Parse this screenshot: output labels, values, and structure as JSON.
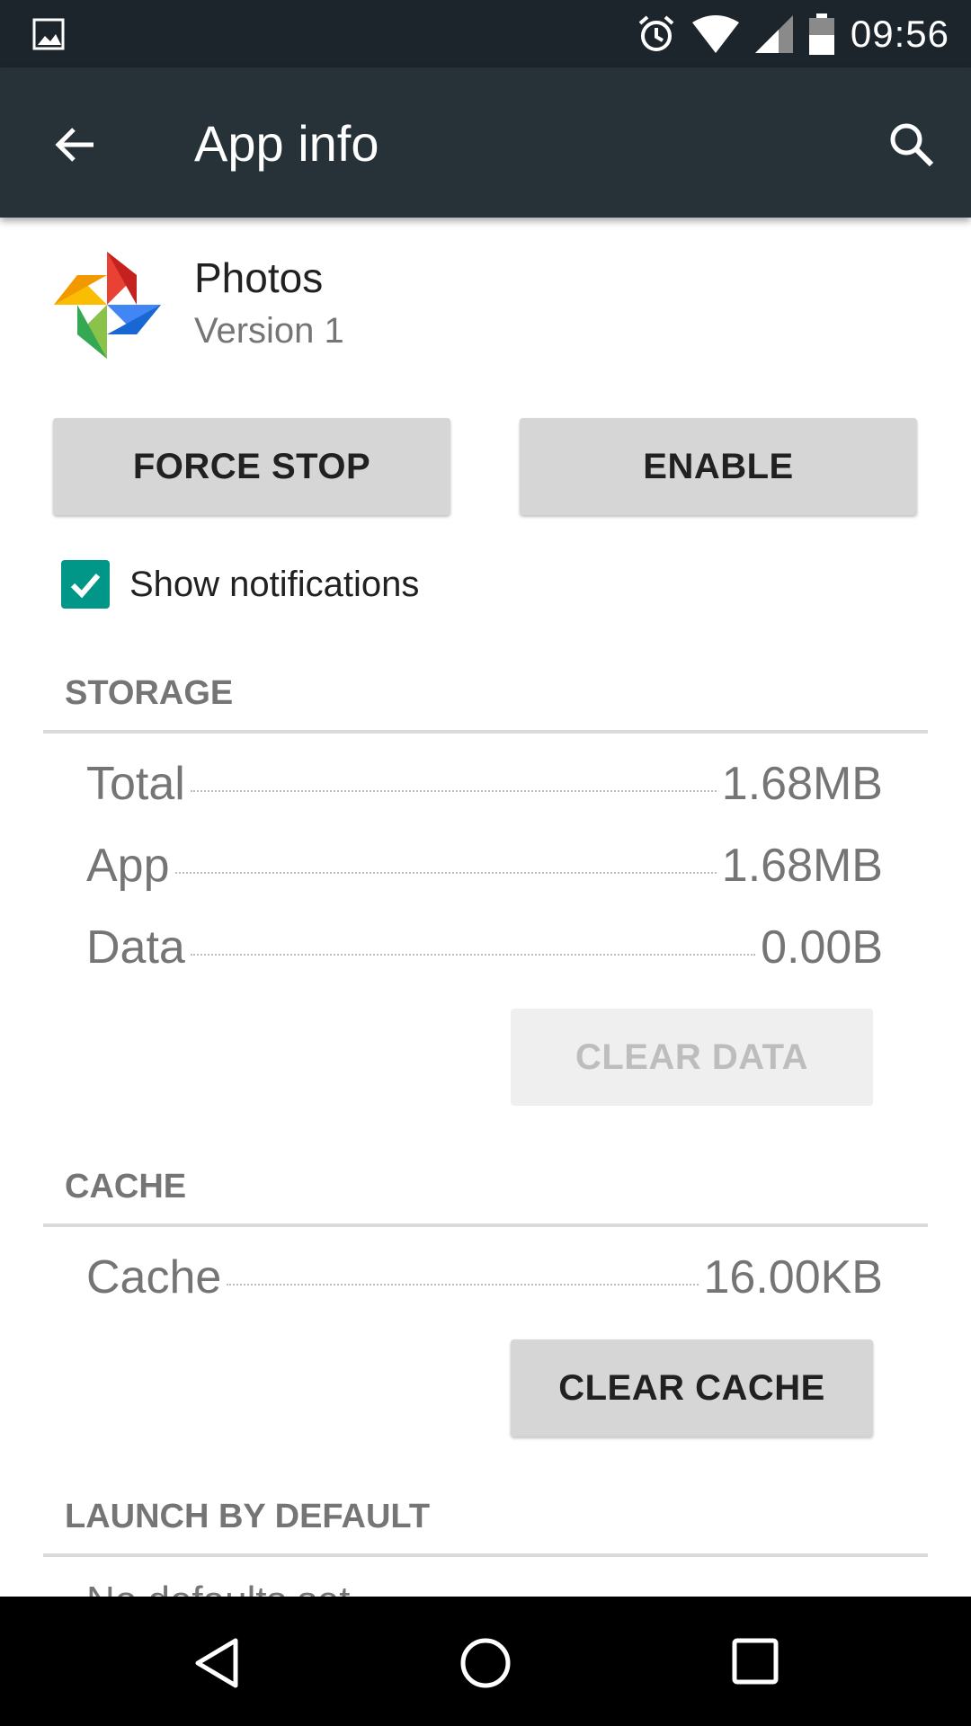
{
  "status_bar": {
    "time": "09:56",
    "icons": [
      "image-notification-icon",
      "alarm-icon",
      "wifi-icon",
      "signal-icon",
      "battery-icon"
    ]
  },
  "toolbar": {
    "title": "App info",
    "back_icon": "arrow-back-icon",
    "search_icon": "search-icon",
    "bg_color": "#263238"
  },
  "app": {
    "name": "Photos",
    "version": "Version 1",
    "icon": "google-photos-pinwheel-icon"
  },
  "actions": {
    "force_stop_label": "FORCE STOP",
    "enable_label": "ENABLE"
  },
  "notifications": {
    "label": "Show notifications",
    "checked": true,
    "accent_color": "#009688"
  },
  "storage": {
    "header": "STORAGE",
    "rows": [
      {
        "label": "Total",
        "value": "1.68MB"
      },
      {
        "label": "App",
        "value": "1.68MB"
      },
      {
        "label": "Data",
        "value": "0.00B"
      }
    ],
    "clear_data_label": "CLEAR DATA",
    "clear_data_enabled": false
  },
  "cache": {
    "header": "CACHE",
    "rows": [
      {
        "label": "Cache",
        "value": "16.00KB"
      }
    ],
    "clear_cache_label": "CLEAR CACHE"
  },
  "launch_default": {
    "header": "LAUNCH BY DEFAULT",
    "partial_text": "No defaults set."
  },
  "nav_bar": {
    "icons": [
      "back-nav-icon",
      "home-nav-icon",
      "recents-nav-icon"
    ]
  }
}
